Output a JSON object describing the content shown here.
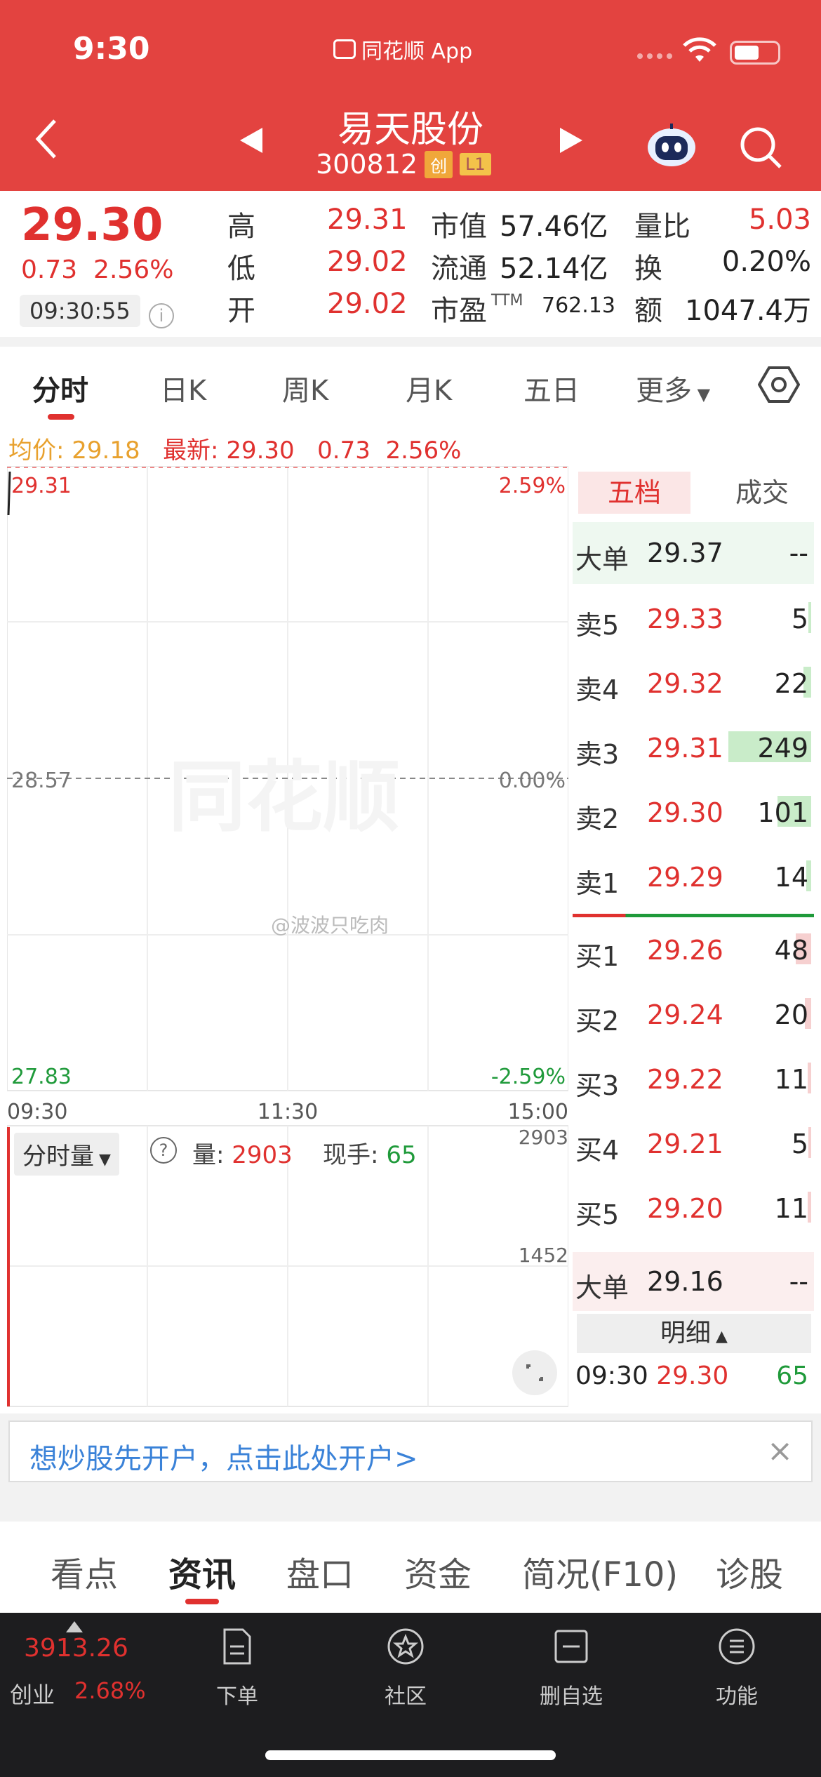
{
  "status_bar": {
    "time": "9:30",
    "app": "同花顺 App"
  },
  "header": {
    "title": "易天股份",
    "code": "300812",
    "badge1": "创",
    "badge2": "L1"
  },
  "quote": {
    "price": "29.30",
    "change": "0.73",
    "change_pct": "2.56%",
    "timestamp": "09:30:55",
    "high_label": "高",
    "high": "29.31",
    "low_label": "低",
    "low": "29.02",
    "open_label": "开",
    "open": "29.02",
    "mcap_label": "市值",
    "mcap": "57.46亿",
    "float_label": "流通",
    "float": "52.14亿",
    "pe_label": "市盈",
    "pe_sup": "TTM",
    "pe": "762.13",
    "vr_label": "量比",
    "vr": "5.03",
    "turnover_label": "换",
    "turnover": "0.20%",
    "amount_label": "额",
    "amount": "1047.4万"
  },
  "tabs": [
    "分时",
    "日K",
    "周K",
    "月K",
    "五日",
    "更多"
  ],
  "avg_line": {
    "avg_label": "均价:",
    "avg": "29.18",
    "latest_label": "最新:",
    "latest": "29.30",
    "chg": "0.73",
    "pct": "2.56%"
  },
  "chart": {
    "top_price": "29.31",
    "top_pct": "2.59%",
    "mid_price": "28.57",
    "mid_pct": "0.00%",
    "bot_price": "27.83",
    "bot_pct": "-2.59%",
    "time_start": "09:30",
    "time_mid": "11:30",
    "time_end": "15:00",
    "watermark": "同花顺",
    "weibo": "@波波只吃肉"
  },
  "volume": {
    "selector": "分时量",
    "vol_label": "量:",
    "vol": "2903",
    "hand_label": "现手:",
    "hand": "65",
    "top": "2903",
    "mid": "1452"
  },
  "book": {
    "tab_active": "五档",
    "tab_other": "成交",
    "big_sell_label": "大单",
    "big_sell_price": "29.37",
    "big_sell_vol": "--",
    "asks": [
      {
        "label": "卖5",
        "price": "29.33",
        "vol": "5",
        "fill": 0.02
      },
      {
        "label": "卖4",
        "price": "29.32",
        "vol": "22",
        "fill": 0.09
      },
      {
        "label": "卖3",
        "price": "29.31",
        "vol": "249",
        "fill": 1.0
      },
      {
        "label": "卖2",
        "price": "29.30",
        "vol": "101",
        "fill": 0.41
      },
      {
        "label": "卖1",
        "price": "29.29",
        "vol": "14",
        "fill": 0.06
      }
    ],
    "bids": [
      {
        "label": "买1",
        "price": "29.26",
        "vol": "48",
        "fill": 0.19
      },
      {
        "label": "买2",
        "price": "29.24",
        "vol": "20",
        "fill": 0.08
      },
      {
        "label": "买3",
        "price": "29.22",
        "vol": "11",
        "fill": 0.04
      },
      {
        "label": "买4",
        "price": "29.21",
        "vol": "5",
        "fill": 0.02
      },
      {
        "label": "买5",
        "price": "29.20",
        "vol": "11",
        "fill": 0.04
      }
    ],
    "big_buy_label": "大单",
    "big_buy_price": "29.16",
    "big_buy_vol": "--",
    "detail_label": "明细",
    "detail_time": "09:30",
    "detail_price": "29.30",
    "detail_vol": "65"
  },
  "banner": {
    "text": "想炒股先开户，点击此处开户>",
    "close": "×"
  },
  "bottom_tabs": [
    "看点",
    "资讯",
    "盘口",
    "资金",
    "简况(F10)",
    "诊股"
  ],
  "bottom_bar": {
    "index_value": "3913.26",
    "index_name": "创业",
    "index_pct": "2.68%",
    "buttons": [
      {
        "label": "下单",
        "icon": "order-icon"
      },
      {
        "label": "社区",
        "icon": "community-icon"
      },
      {
        "label": "删自选",
        "icon": "remove-watchlist-icon"
      },
      {
        "label": "功能",
        "icon": "menu-icon"
      }
    ]
  },
  "colors": {
    "header": "#e34340",
    "up": "#e0312f",
    "down": "#1f9a3a",
    "link": "#3a82d8"
  }
}
